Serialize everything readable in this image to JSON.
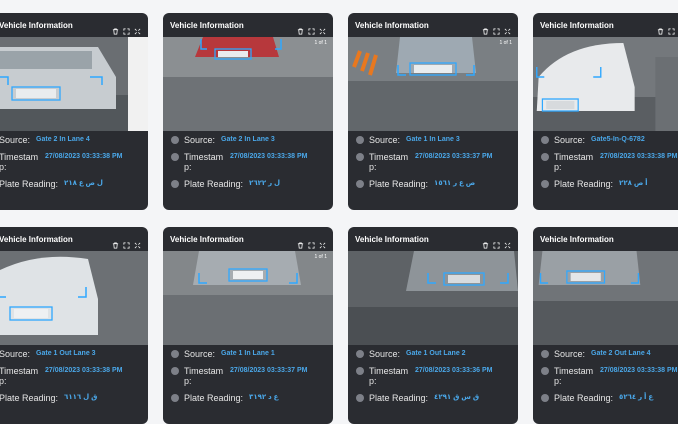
{
  "panel_title": "Vehicle Information",
  "source_label": "Source:",
  "timestamp_label": "Timestam p:",
  "plate_label": "Plate Reading:",
  "accent": "#4aa7e8",
  "cards": [
    {
      "source": "Gate 2 In Lane 4",
      "time": "27/08/2023 03:33:38 PM",
      "plate": "ل ص ع ٢١٨",
      "page": ""
    },
    {
      "source": "Gate 2 In Lane 3",
      "time": "27/08/2023 03:33:38 PM",
      "plate": "ل ر ٢٦٢٢",
      "page": "1 of 1"
    },
    {
      "source": "Gate 1 In Lane 3",
      "time": "27/08/2023 03:33:37 PM",
      "plate": "ص ع ر ١٥٦١",
      "page": "1 of 1"
    },
    {
      "source": "Gate5-In-Q-6782",
      "time": "27/08/2023 03:33:38 PM",
      "plate": "أ ص ٢٢٨",
      "page": ""
    },
    {
      "source": "Gate 1 Out Lane 3",
      "time": "27/08/2023 03:33:38 PM",
      "plate": "ق ل ٦١١٦",
      "page": ""
    },
    {
      "source": "Gate 1 In Lane 1",
      "time": "27/08/2023 03:33:37 PM",
      "plate": "ع د ٣١٩٢",
      "page": "1 of 1"
    },
    {
      "source": "Gate 1 Out Lane 2",
      "time": "27/08/2023 03:33:36 PM",
      "plate": "ق س ق ٤٢٩١",
      "page": ""
    },
    {
      "source": "Gate 2 Out Lane 4",
      "time": "27/08/2023 03:33:38 PM",
      "plate": "ع أ ر ٥٢٦٤",
      "page": ""
    }
  ]
}
